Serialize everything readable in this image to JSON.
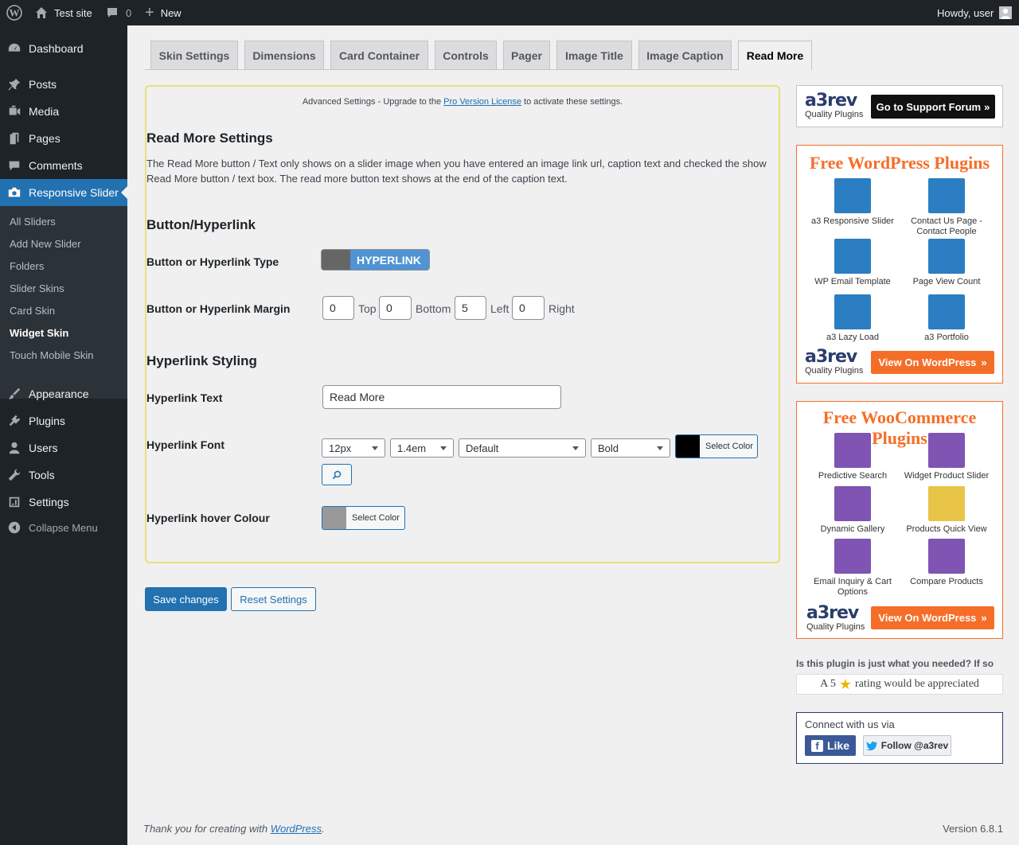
{
  "adminbar": {
    "site_name": "Test site",
    "comments_count": "0",
    "new_label": "New",
    "howdy": "Howdy, user"
  },
  "sidebar": {
    "items": [
      {
        "label": "Dashboard",
        "icon": "dashboard-icon"
      },
      {
        "label": "Posts",
        "icon": "pin-icon"
      },
      {
        "label": "Media",
        "icon": "media-icon"
      },
      {
        "label": "Pages",
        "icon": "page-icon"
      },
      {
        "label": "Comments",
        "icon": "comment-icon"
      },
      {
        "label": "Responsive Slider",
        "icon": "camera-icon"
      },
      {
        "label": "Appearance",
        "icon": "brush-icon"
      },
      {
        "label": "Plugins",
        "icon": "plug-icon"
      },
      {
        "label": "Users",
        "icon": "user-icon"
      },
      {
        "label": "Tools",
        "icon": "wrench-icon"
      },
      {
        "label": "Settings",
        "icon": "settings-icon"
      },
      {
        "label": "Collapse Menu",
        "icon": "collapse-icon"
      }
    ],
    "submenu": [
      "All Sliders",
      "Add New Slider",
      "Folders",
      "Slider Skins",
      "Card Skin",
      "Widget Skin",
      "Touch Mobile Skin"
    ]
  },
  "tabs": [
    "Skin Settings",
    "Dimensions",
    "Card Container",
    "Controls",
    "Pager",
    "Image Title",
    "Image Caption",
    "Read More"
  ],
  "panel": {
    "notice_before": "Advanced Settings - Upgrade to the ",
    "notice_link": "Pro Version License",
    "notice_after": " to activate these settings.",
    "title": "Read More Settings",
    "description": "The Read More button / Text only shows on a slider image when you have entered an image link url, caption text and checked the show Read More button / text box. The read more button text shows at the end of the caption text.",
    "section_button": "Button/Hyperlink",
    "type_label": "Button or Hyperlink Type",
    "type_toggle": "HYPERLINK",
    "margin_label": "Button or Hyperlink Margin",
    "margins": [
      {
        "value": "0",
        "label": "Top"
      },
      {
        "value": "0",
        "label": "Bottom"
      },
      {
        "value": "5",
        "label": "Left"
      },
      {
        "value": "0",
        "label": "Right"
      }
    ],
    "section_styling": "Hyperlink Styling",
    "text_label": "Hyperlink Text",
    "text_value": "Read More",
    "font_label": "Hyperlink Font",
    "font_size": "12px",
    "line_height": "1.4em",
    "font_family": "Default",
    "font_weight": "Bold",
    "font_color": "#000000",
    "select_color": "Select Color",
    "hover_label": "Hyperlink hover Colour",
    "hover_color": "#999999"
  },
  "buttons": {
    "save": "Save changes",
    "reset": "Reset Settings"
  },
  "right": {
    "support_btn": "Go to Support Forum",
    "logo_text": "a3rev",
    "logo_sub": "Quality Plugins",
    "wp_title": "Free WordPress Plugins",
    "wp_plugins": [
      "a3 Responsive Slider",
      "Contact Us Page - Contact People",
      "WP Email Template",
      "Page View Count",
      "a3 Lazy Load",
      "a3 Portfolio"
    ],
    "woo_title": "Free WooCommerce Plugins",
    "woo_plugins": [
      "Predictive Search",
      "Widget Product Slider",
      "Dynamic Gallery",
      "Products Quick View",
      "Email Inquiry & Cart Options",
      "Compare Products"
    ],
    "view_btn": "View On WordPress",
    "rating_q": "Is this plugin is just what you needed? If so",
    "rating_a_pre": "A 5",
    "rating_a_post": "rating would be appreciated",
    "connect": "Connect with us via",
    "like": "Like",
    "follow": "Follow @a3rev"
  },
  "footer": {
    "thanks_pre": "Thank you for creating with ",
    "thanks_link": "WordPress",
    "thanks_post": ".",
    "version": "Version 6.8.1"
  },
  "colors": {
    "accent": "#2271b1",
    "orange": "#f56e28",
    "toggle": "#4f94d4",
    "woo": "#7f54b3"
  }
}
